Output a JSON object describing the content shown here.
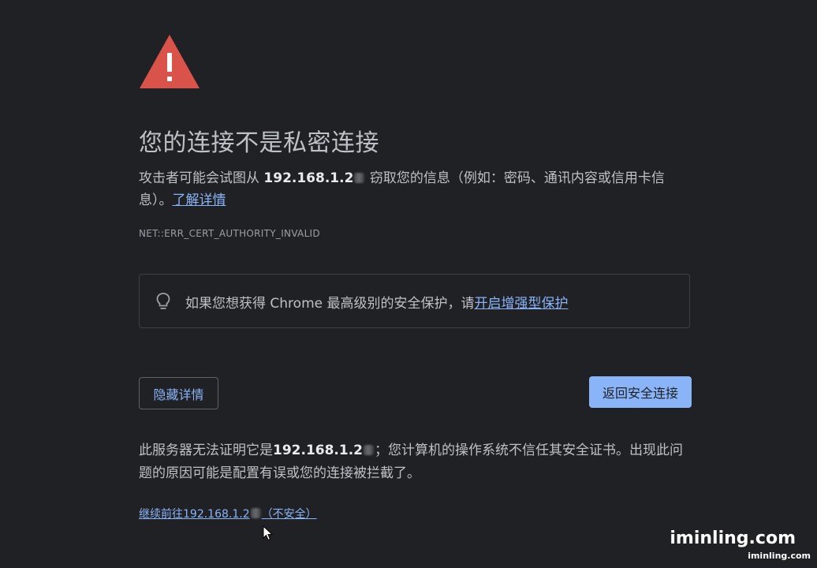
{
  "icons": {
    "warning": "warning-triangle-icon",
    "bulb": "lightbulb-icon",
    "cursor": "mouse-pointer-icon"
  },
  "colors": {
    "background": "#202124",
    "warning_red": "#d9534a",
    "link_blue": "#8ab4f8",
    "text": "#bdc1c6"
  },
  "interstitial": {
    "title": "您的连接不是私密连接",
    "desc_part1": "攻击者可能会试图从 ",
    "desc_host": "192.168.1.2",
    "desc_part2": " 窃取您的信息（例如：密码、通讯内容或信用卡信息）。",
    "learn_more": "了解详情",
    "error_code": "NET::ERR_CERT_AUTHORITY_INVALID",
    "enhanced_prefix": "如果您想获得 Chrome 最高级别的安全保护，请",
    "enhanced_link": "开启增强型保护",
    "hide_details_label": "隐藏详情",
    "back_to_safety_label": "返回安全连接",
    "details_part1": "此服务器无法证明它是",
    "details_host": "192.168.1.2",
    "details_part2": "；您计算机的操作系统不信任其安全证书。出现此问题的原因可能是配置有误或您的连接被拦截了。",
    "proceed_prefix": "继续前往192.168.1.2",
    "proceed_suffix": "（不安全）"
  },
  "watermark": {
    "large": "iminling.com",
    "small": "iminling.com"
  }
}
